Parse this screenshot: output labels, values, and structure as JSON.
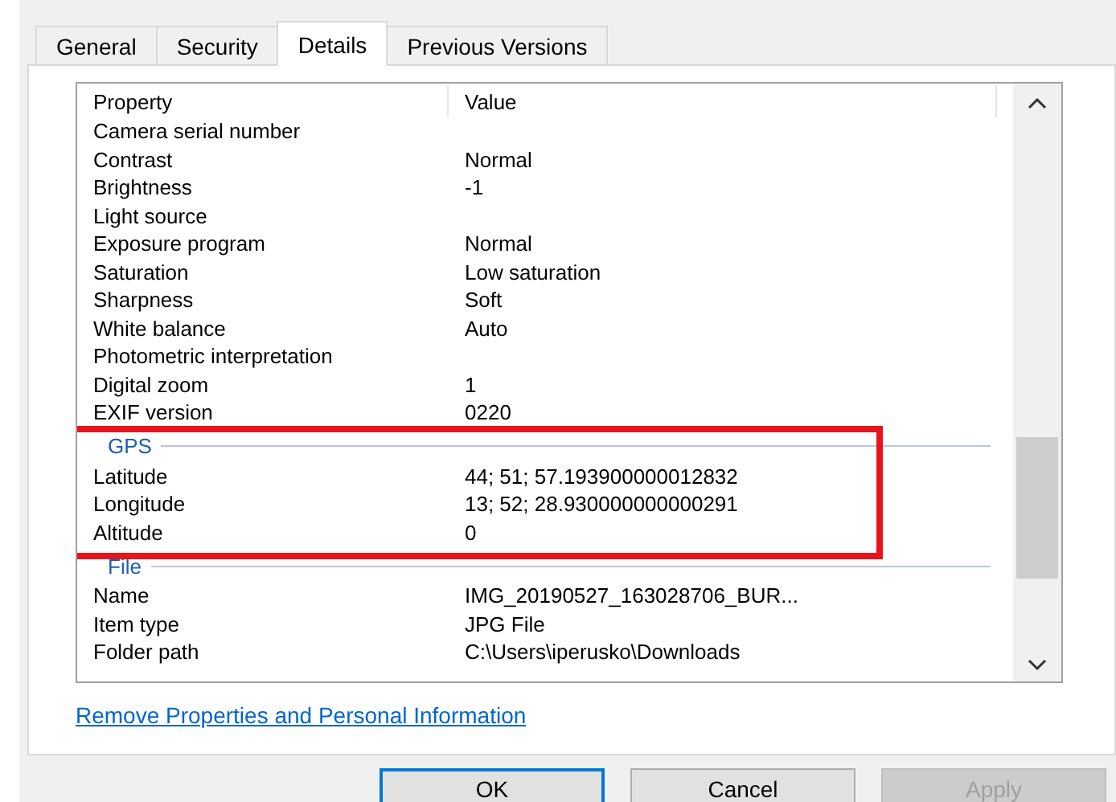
{
  "tabs": [
    {
      "label": "General",
      "selected": false
    },
    {
      "label": "Security",
      "selected": false
    },
    {
      "label": "Details",
      "selected": true
    },
    {
      "label": "Previous Versions",
      "selected": false
    }
  ],
  "columns": [
    "Property",
    "Value"
  ],
  "rows": [
    {
      "kind": "row",
      "property": "Camera serial number",
      "value": ""
    },
    {
      "kind": "row",
      "property": "Contrast",
      "value": "Normal"
    },
    {
      "kind": "row",
      "property": "Brightness",
      "value": "-1"
    },
    {
      "kind": "row",
      "property": "Light source",
      "value": ""
    },
    {
      "kind": "row",
      "property": "Exposure program",
      "value": "Normal"
    },
    {
      "kind": "row",
      "property": "Saturation",
      "value": "Low saturation"
    },
    {
      "kind": "row",
      "property": "Sharpness",
      "value": "Soft"
    },
    {
      "kind": "row",
      "property": "White balance",
      "value": "Auto"
    },
    {
      "kind": "row",
      "property": "Photometric interpretation",
      "value": ""
    },
    {
      "kind": "row",
      "property": "Digital zoom",
      "value": "1"
    },
    {
      "kind": "row",
      "property": "EXIF version",
      "value": "0220"
    },
    {
      "kind": "group",
      "title": "GPS",
      "highlighted": true,
      "rows": [
        {
          "property": "Latitude",
          "value": "44; 51; 57.193900000012832"
        },
        {
          "property": "Longitude",
          "value": "13; 52; 28.930000000000291"
        },
        {
          "property": "Altitude",
          "value": "0"
        }
      ]
    },
    {
      "kind": "group",
      "title": "File",
      "highlighted": false,
      "rows": [
        {
          "property": "Name",
          "value": "IMG_20190527_163028706_BUR..."
        },
        {
          "property": "Item type",
          "value": "JPG File"
        },
        {
          "property": "Folder path",
          "value": "C:\\Users\\iperusko\\Downloads"
        }
      ]
    }
  ],
  "link": "Remove Properties and Personal Information",
  "buttons": [
    {
      "label": "OK",
      "default": true,
      "disabled": false
    },
    {
      "label": "Cancel",
      "default": false,
      "disabled": false
    },
    {
      "label": "Apply",
      "default": false,
      "disabled": true
    }
  ]
}
